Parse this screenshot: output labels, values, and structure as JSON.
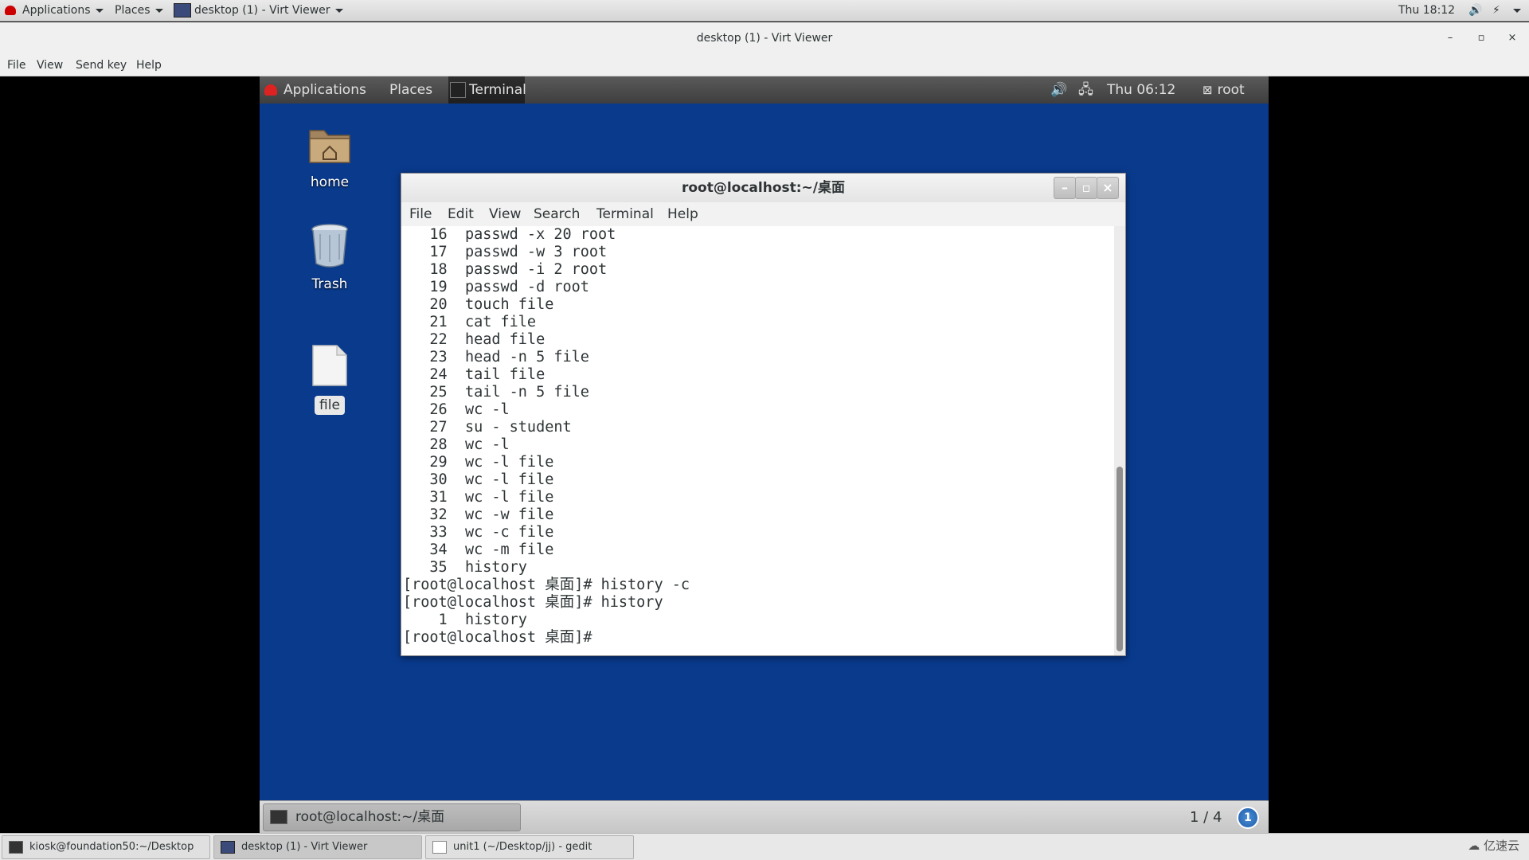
{
  "host_topbar": {
    "applications": "Applications",
    "places": "Places",
    "active_window": "desktop (1) - Virt Viewer",
    "clock": "Thu 18:12"
  },
  "viewer_window": {
    "title": "desktop (1) - Virt Viewer",
    "minimize": "–",
    "maximize": "▫",
    "close": "×",
    "menu": [
      "File",
      "View",
      "Send key",
      "Help"
    ]
  },
  "guest_topbar": {
    "applications": "Applications",
    "places": "Places",
    "terminal": "Terminal",
    "clock": "Thu 06:12",
    "user": "root"
  },
  "desktop_icons": {
    "home": "home",
    "trash": "Trash",
    "file": "file"
  },
  "terminal": {
    "title": "root@localhost:~/桌面",
    "menu": [
      "File",
      "Edit",
      "View",
      "Search",
      "Terminal",
      "Help"
    ],
    "lines": [
      "   16  passwd -x 20 root",
      "   17  passwd -w 3 root",
      "   18  passwd -i 2 root",
      "   19  passwd -d root",
      "   20  touch file",
      "   21  cat file",
      "   22  head file",
      "   23  head -n 5 file",
      "   24  tail file",
      "   25  tail -n 5 file",
      "   26  wc -l",
      "   27  su - student",
      "   28  wc -l",
      "   29  wc -l file",
      "   30  wc -l file",
      "   31  wc -l file",
      "   32  wc -w file",
      "   33  wc -c file",
      "   34  wc -m file",
      "   35  history",
      "[root@localhost 桌面]# history -c",
      "[root@localhost 桌面]# history",
      "    1  history",
      "[root@localhost 桌面]#"
    ]
  },
  "guest_bottombar": {
    "task": "root@localhost:~/桌面",
    "workspace": "1 / 4",
    "notifications": "1"
  },
  "host_taskbar": {
    "tasks": [
      "kiosk@foundation50:~/Desktop",
      "desktop (1) - Virt Viewer",
      "unit1 (~/Desktop/jj) - gedit"
    ],
    "watermark": "亿速云"
  }
}
